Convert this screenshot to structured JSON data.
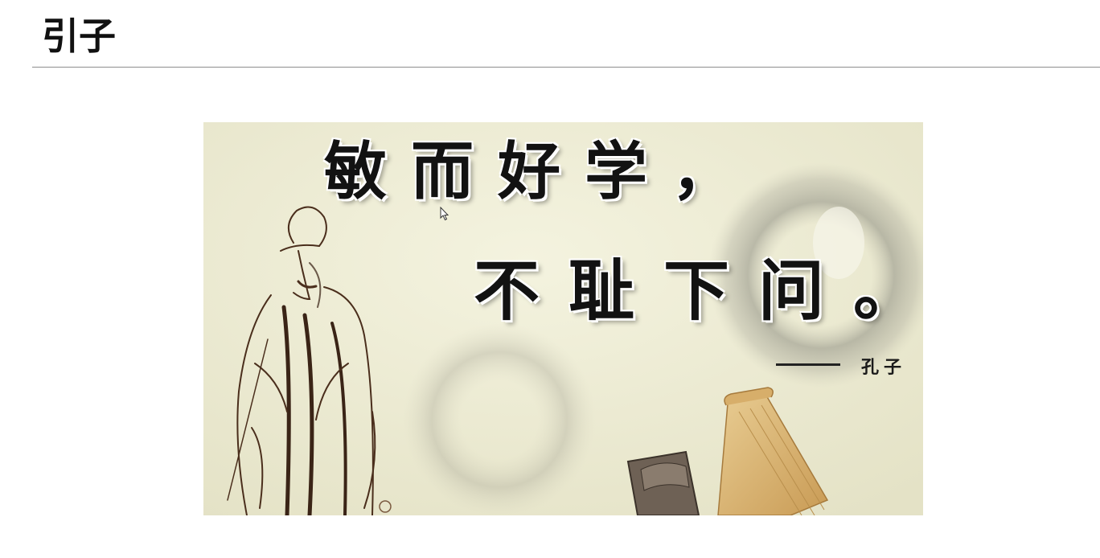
{
  "slide": {
    "title": "引子"
  },
  "poster": {
    "quote_line1": "敏而好学，",
    "quote_line2": "不耻下问。",
    "attribution_name": "孔子",
    "attribution_dash": "——",
    "illustration_icons": [
      "confucius-figure",
      "ink-circle",
      "scroll"
    ],
    "colors": {
      "background": "#ecebd2",
      "ink": "#121212",
      "scroll": "#d9b777"
    }
  },
  "cursor": {
    "icon": "pointer-arrow-icon"
  }
}
